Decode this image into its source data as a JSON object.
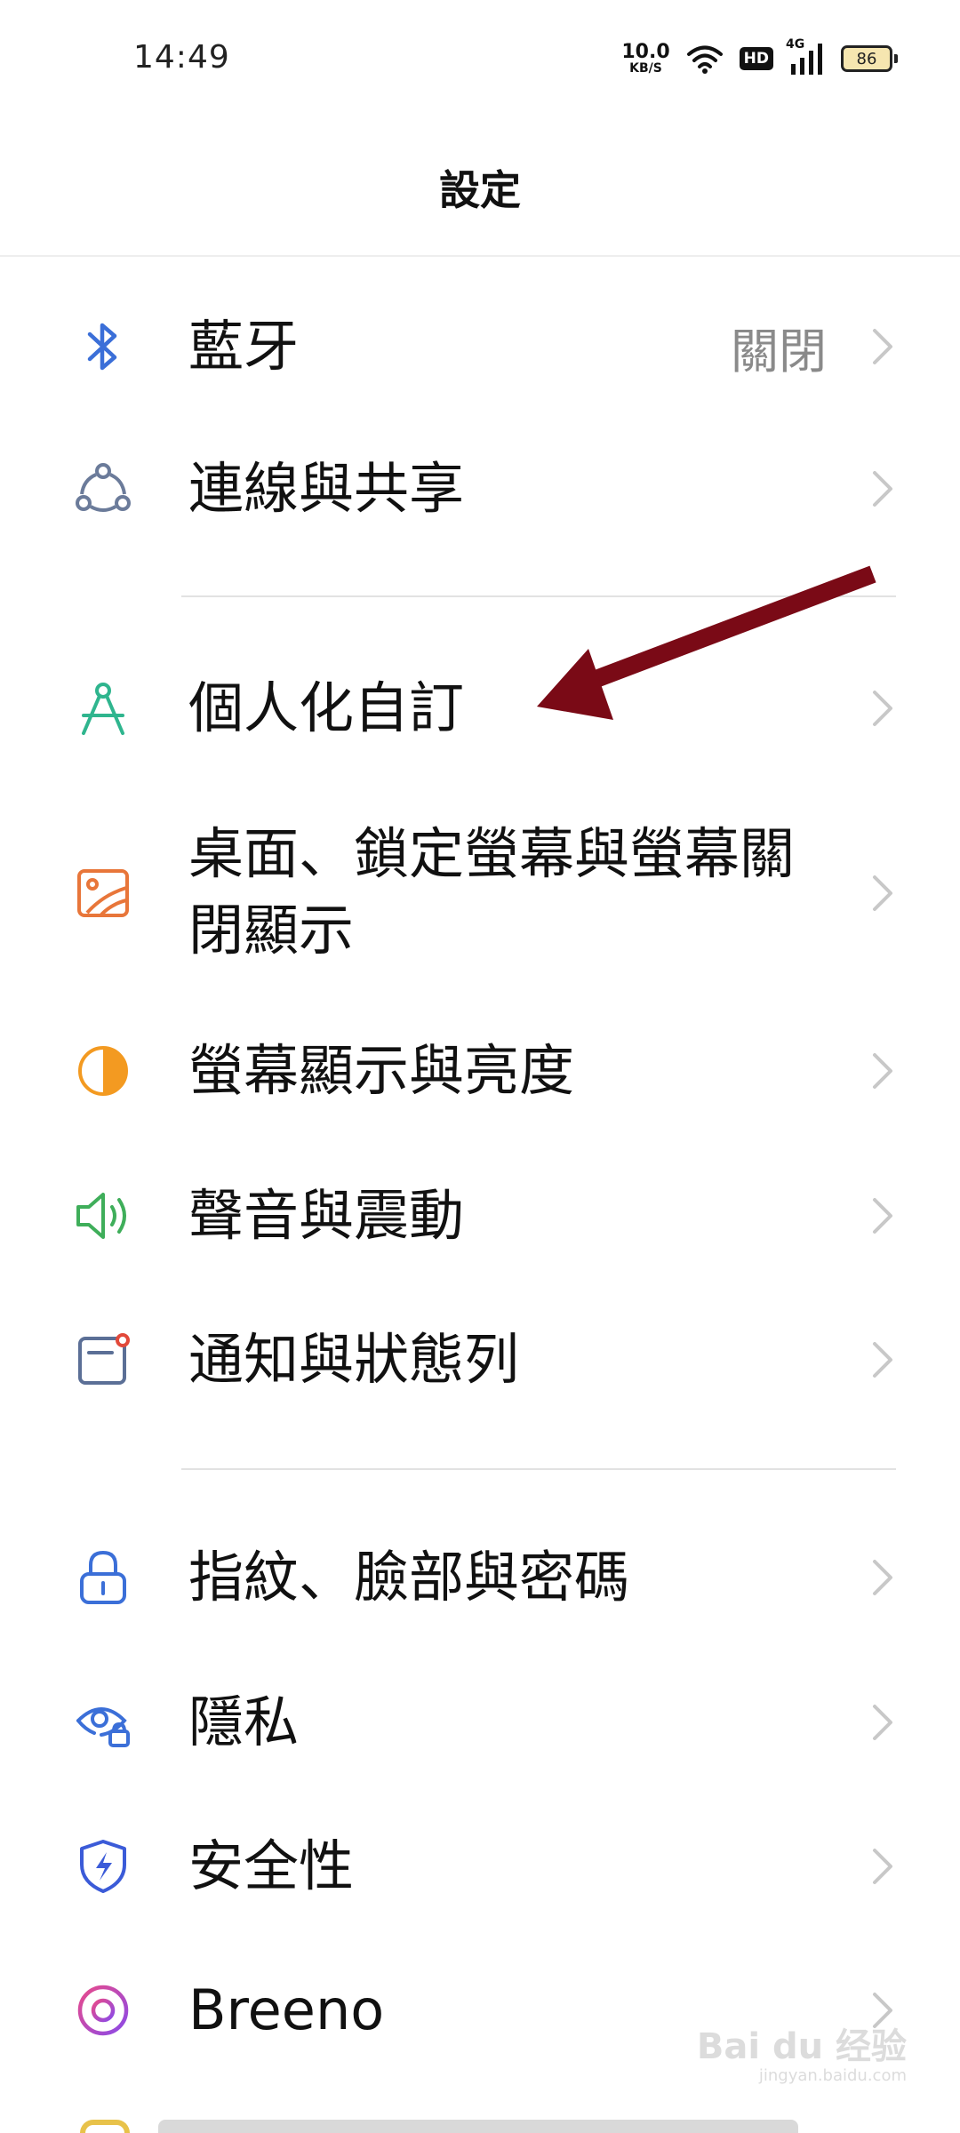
{
  "status_bar": {
    "time": "14:49",
    "net_speed_value": "10.0",
    "net_speed_unit": "KB/S",
    "hd_label": "HD",
    "network_gen": "4G",
    "battery_level": "86"
  },
  "header": {
    "title": "設定"
  },
  "settings": {
    "items": [
      {
        "label": "藍牙",
        "value": "關閉",
        "icon": "bluetooth-icon",
        "color": "#3b6fd8"
      },
      {
        "label": "連線與共享",
        "icon": "connection-share-icon",
        "color": "#6b7b9a"
      },
      {
        "label": "個人化自訂",
        "icon": "personalization-icon",
        "color": "#2fb58e"
      },
      {
        "label": "桌面、鎖定螢幕與螢幕關",
        "label_line2": "閉顯示",
        "icon": "wallpaper-icon",
        "color": "#e8763a"
      },
      {
        "label": "螢幕顯示與亮度",
        "icon": "brightness-icon",
        "color": "#f39a21"
      },
      {
        "label": "聲音與震動",
        "icon": "sound-icon",
        "color": "#3fae5a"
      },
      {
        "label": "通知與狀態列",
        "icon": "notification-icon",
        "color": "#5b6f96"
      },
      {
        "label": "指紋、臉部與密碼",
        "icon": "lock-icon",
        "color": "#3b6fd8"
      },
      {
        "label": "隱私",
        "icon": "privacy-eye-icon",
        "color": "#3b6fd8"
      },
      {
        "label": "安全性",
        "icon": "security-shield-icon",
        "color": "#3b5bd8"
      },
      {
        "label": "Breeno",
        "icon": "breeno-icon",
        "color": "#c04ad8"
      }
    ]
  },
  "annotation": {
    "arrow_color": "#7a0a16"
  },
  "watermark": {
    "brand": "Bai du 经验",
    "url": "jingyan.baidu.com"
  }
}
